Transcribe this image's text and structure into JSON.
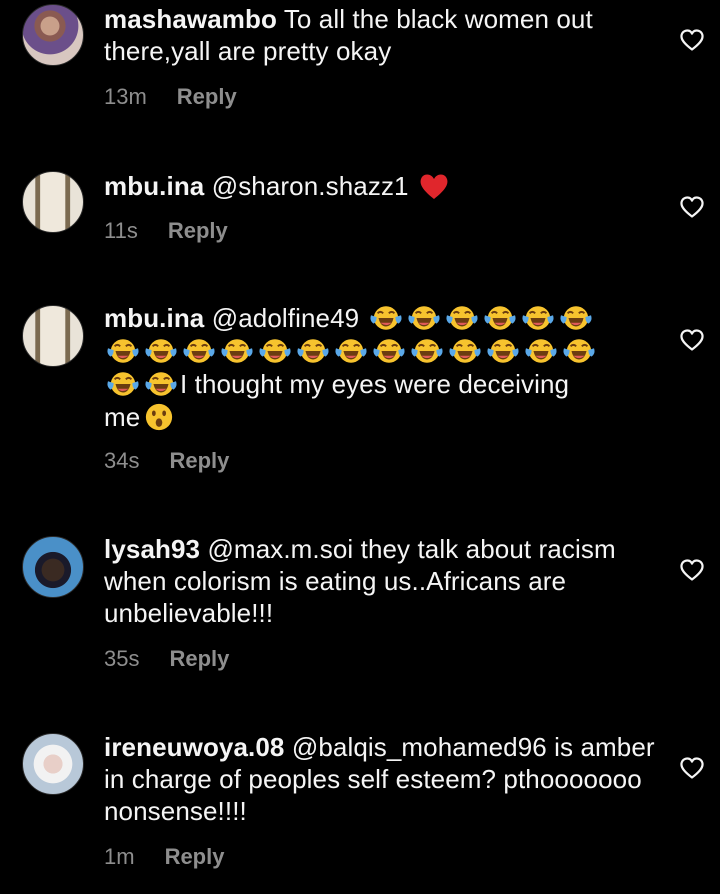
{
  "colors": {
    "background": "#000000",
    "text": "#f5f5f5",
    "meta": "#8e8e8e",
    "heart_red": "#e0262c",
    "emoji_yellow": "#f7c32e"
  },
  "icons": {
    "like": "heart-outline-icon",
    "red_heart": "red-heart-emoji",
    "tears_of_joy": "face-with-tears-of-joy-emoji",
    "surprised": "face-with-open-mouth-emoji"
  },
  "comments": [
    {
      "username": "mashawambo",
      "text": "To all the black women out there,yall are pretty okay",
      "time": "13m",
      "reply": "Reply"
    },
    {
      "username": "mbu.ina",
      "text": "@sharon.shazz1",
      "time": "11s",
      "reply": "Reply"
    },
    {
      "username": "mbu.ina",
      "mention": "@adolfine49",
      "text": "I thought my eyes were deceiving",
      "text_end": "me",
      "laugh_emoji_count": 21,
      "time": "34s",
      "reply": "Reply"
    },
    {
      "username": "lysah93",
      "text": "@max.m.soi they talk about racism when colorism is eating us..Africans are unbelievable!!!",
      "time": "35s",
      "reply": "Reply"
    },
    {
      "username": "ireneuwoya.08",
      "text": "@balqis_mohamed96 is amber in charge of peoples self esteem? pthooooooo nonsense!!!!",
      "time": "1m",
      "reply": "Reply"
    }
  ]
}
